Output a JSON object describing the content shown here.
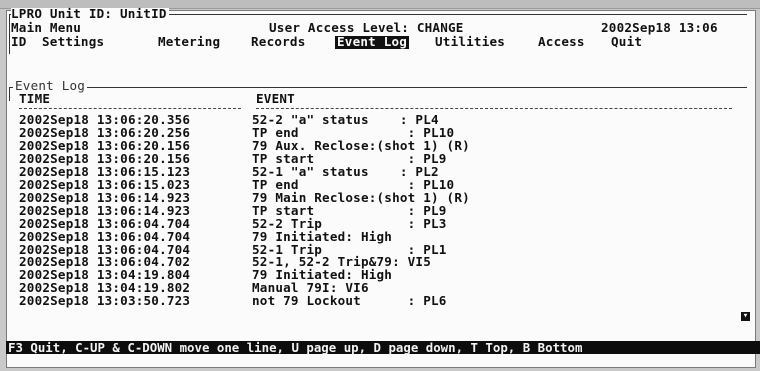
{
  "header": {
    "unit_title": "LPRO Unit ID: UnitID",
    "menu_label": "Main Menu",
    "user_level": "User Access Level: CHANGE",
    "datetime": "2002Sep18 13:06"
  },
  "menu": {
    "items": [
      {
        "label": "ID"
      },
      {
        "label": "Settings"
      },
      {
        "label": "Metering"
      },
      {
        "label": "Records"
      },
      {
        "label": "Event Log"
      },
      {
        "label": "Utilities"
      },
      {
        "label": "Access"
      },
      {
        "label": "Quit"
      }
    ],
    "active": "Event Log"
  },
  "event_log": {
    "frame_label": "Event Log",
    "columns": {
      "time": "TIME",
      "event": "EVENT"
    },
    "rows": [
      {
        "time": "2002Sep18 13:06:20.356",
        "event": "52-2 \"a\" status    : PL4"
      },
      {
        "time": "2002Sep18 13:06:20.256",
        "event": "TP end              : PL10"
      },
      {
        "time": "2002Sep18 13:06:20.156",
        "event": "79 Aux. Reclose:(shot 1) (R)"
      },
      {
        "time": "2002Sep18 13:06:20.156",
        "event": "TP start            : PL9"
      },
      {
        "time": "2002Sep18 13:06:15.123",
        "event": "52-1 \"a\" status    : PL2"
      },
      {
        "time": "2002Sep18 13:06:15.023",
        "event": "TP end              : PL10"
      },
      {
        "time": "2002Sep18 13:06:14.923",
        "event": "79 Main Reclose:(shot 1) (R)"
      },
      {
        "time": "2002Sep18 13:06:14.923",
        "event": "TP start            : PL9"
      },
      {
        "time": "2002Sep18 13:06:04.704",
        "event": "52-2 Trip           : PL3"
      },
      {
        "time": "2002Sep18 13:06:04.704",
        "event": "79 Initiated: High"
      },
      {
        "time": "2002Sep18 13:06:04.704",
        "event": "52-1 Trip           : PL1"
      },
      {
        "time": "2002Sep18 13:06:04.702",
        "event": "52-1, 52-2 Trip&79: VI5"
      },
      {
        "time": "2002Sep18 13:04:19.804",
        "event": "79 Initiated: High"
      },
      {
        "time": "2002Sep18 13:04:19.802",
        "event": "Manual 79I: VI6"
      },
      {
        "time": "2002Sep18 13:03:50.723",
        "event": "not 79 Lockout      : PL6"
      }
    ]
  },
  "scroll_indicator_icon": "scroll-down-icon",
  "status_bar": "F3 Quit, C-UP & C-DOWN move one line, U page up, D page down, T Top, B Bottom"
}
